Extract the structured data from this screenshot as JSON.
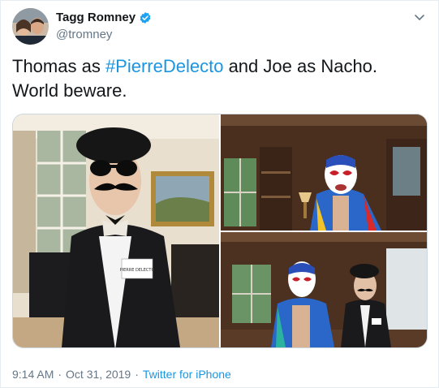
{
  "author": {
    "display_name": "Tagg Romney",
    "handle": "@tromney",
    "verified": true,
    "verified_color": "#1da1f2"
  },
  "tweet": {
    "text_before": "Thomas as ",
    "hashtag": "#PierreDelecto",
    "text_after": " and Joe as Nacho. World beware."
  },
  "media": {
    "photo_count": 3,
    "name_tag_text": "PIERRE DELECTO"
  },
  "meta": {
    "time": "9:14 AM",
    "separator": "·",
    "date": "Oct 31, 2019",
    "source": "Twitter for iPhone"
  },
  "colors": {
    "link": "#1b95e0",
    "secondary_text": "#657786",
    "border": "#e6ecf0"
  },
  "icons": {
    "caret": "chevron-down-icon",
    "verified": "verified-badge-icon"
  }
}
